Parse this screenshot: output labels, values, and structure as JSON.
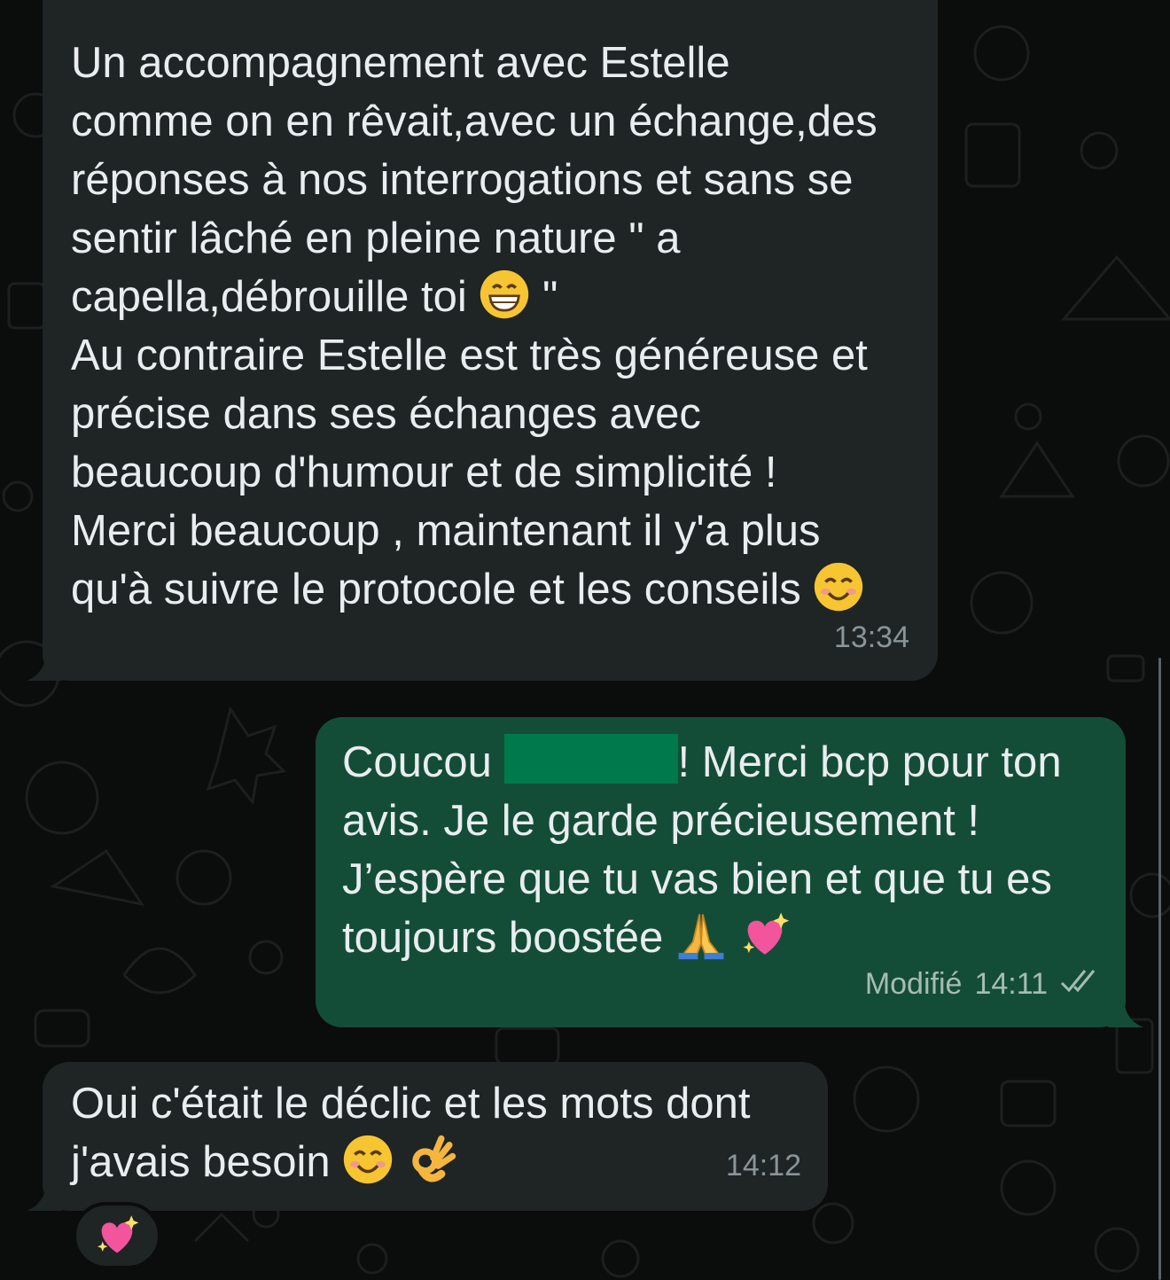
{
  "messages": [
    {
      "direction": "incoming",
      "lines": [
        "Un accompagnement avec Estelle",
        "comme on en rêvait,avec un échange,des",
        "réponses à nos interrogations et sans se",
        "sentir lâché en pleine nature \" a",
        "capella,débrouille toi",
        "Au contraire Estelle est très généreuse et",
        "précise dans ses échanges avec",
        "beaucoup d'humour et de simplicité !",
        "Merci beaucoup , maintenant il y'a plus",
        "qu'à suivre le protocole et les conseils"
      ],
      "line5_suffix": "\"",
      "time": "13:34"
    },
    {
      "direction": "outgoing",
      "line1_before": "Coucou",
      "line1_after": "! Merci bcp pour ton",
      "lines": [
        "avis. Je le garde précieusement !",
        "J’espère que tu vas bien et que tu es",
        "toujours boostée"
      ],
      "edited_label": "Modifié",
      "time": "14:11",
      "status_icon": "double-check-icon"
    },
    {
      "direction": "incoming",
      "lines": [
        "Oui c'était le déclic et les mots dont",
        "j'avais besoin"
      ],
      "time": "14:12",
      "reaction_icon": "sparkling-heart-icon"
    }
  ],
  "colors": {
    "incoming_bubble": "#1f2424",
    "outgoing_bubble": "#144d37",
    "redaction": "#007a4d",
    "background": "#0b0c0c"
  }
}
